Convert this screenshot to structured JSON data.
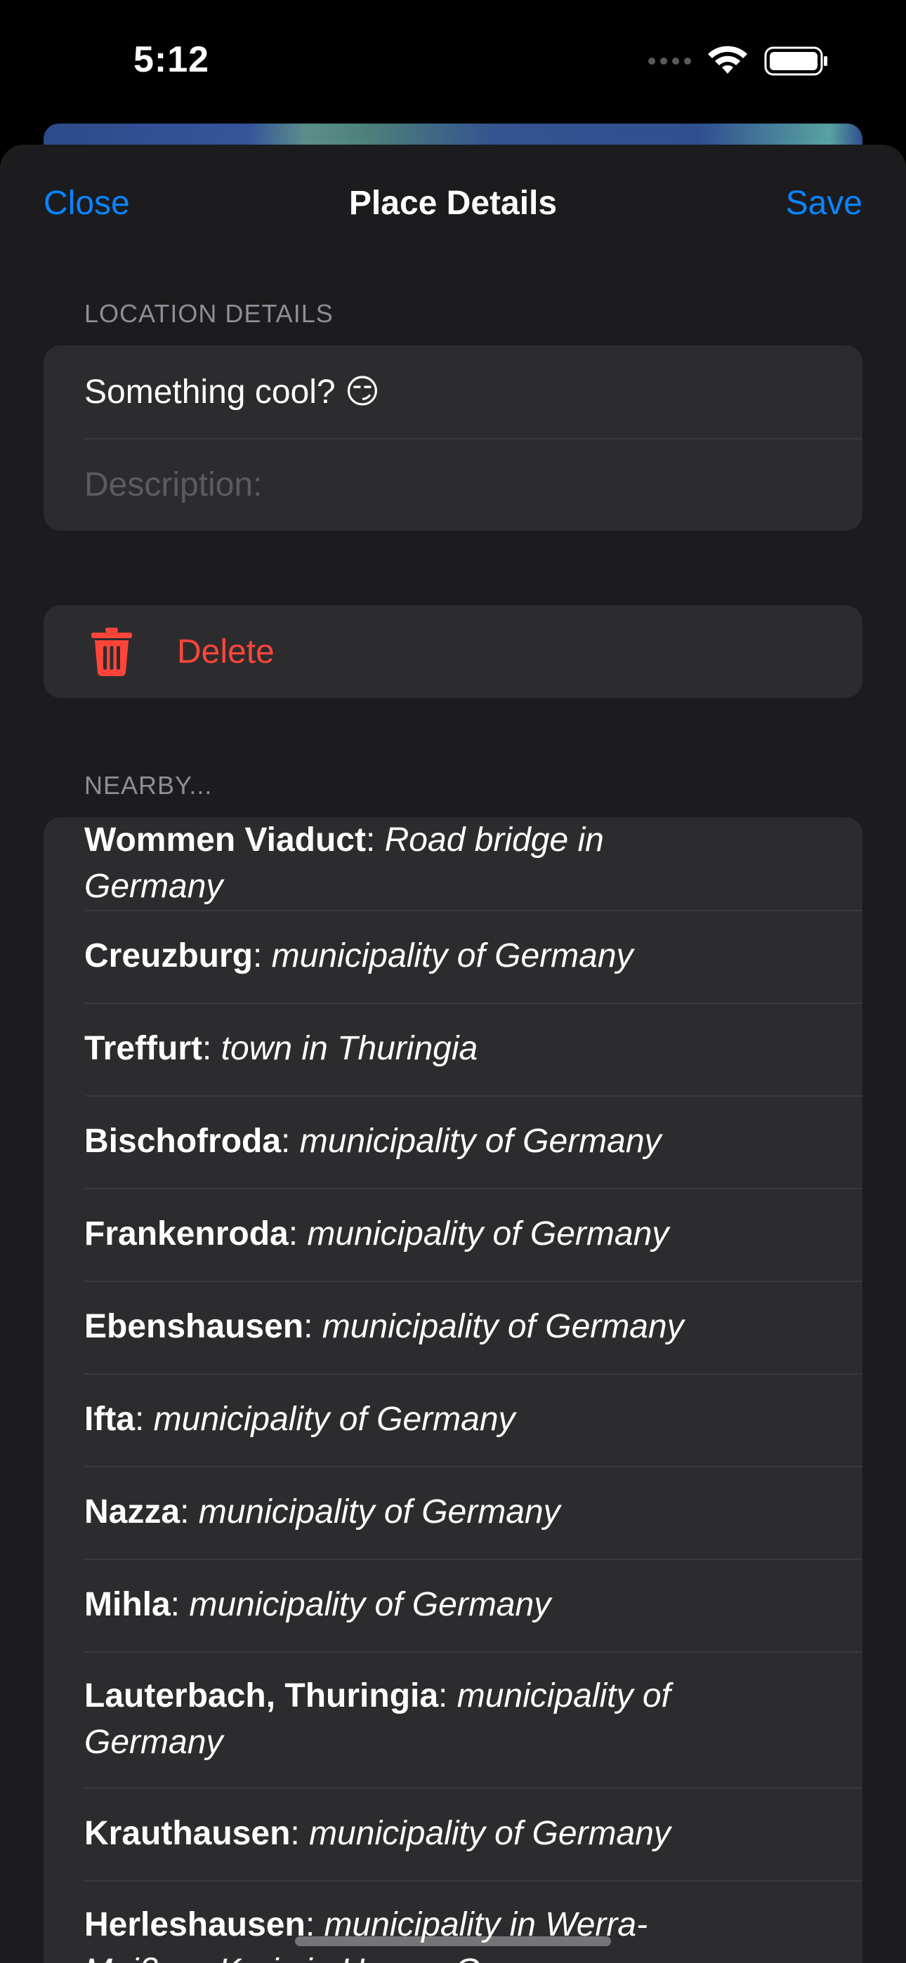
{
  "status_bar": {
    "time": "5:12"
  },
  "nav": {
    "close_label": "Close",
    "title": "Place Details",
    "save_label": "Save"
  },
  "location_section": {
    "header": "LOCATION DETAILS",
    "name_value": "Something cool? 😏",
    "description_placeholder": "Description:"
  },
  "delete": {
    "label": "Delete"
  },
  "nearby": {
    "header": "NEARBY...",
    "items": [
      {
        "name": "Wommen Viaduct",
        "desc": "Road bridge in Germany"
      },
      {
        "name": "Creuzburg",
        "desc": "municipality of Germany"
      },
      {
        "name": "Treffurt",
        "desc": "town in Thuringia"
      },
      {
        "name": "Bischofroda",
        "desc": "municipality of Germany"
      },
      {
        "name": "Frankenroda",
        "desc": "municipality of Germany"
      },
      {
        "name": "Ebenshausen",
        "desc": "municipality of Germany"
      },
      {
        "name": "Ifta",
        "desc": "municipality of Germany"
      },
      {
        "name": "Nazza",
        "desc": "municipality of Germany"
      },
      {
        "name": "Mihla",
        "desc": "municipality of Germany"
      },
      {
        "name": "Lauterbach, Thuringia",
        "desc": "municipality of Germany"
      },
      {
        "name": "Krauthausen",
        "desc": "municipality of Germany"
      },
      {
        "name": "Herleshausen",
        "desc": "municipality in Werra-Meißner-Kreis in Hesse, Germany"
      }
    ]
  },
  "colors": {
    "accent": "#0a84ff",
    "destructive": "#ff453a",
    "sheet_background": "#1c1c1e",
    "group_background": "#2c2c2e",
    "secondary_text": "#8e8e93"
  }
}
